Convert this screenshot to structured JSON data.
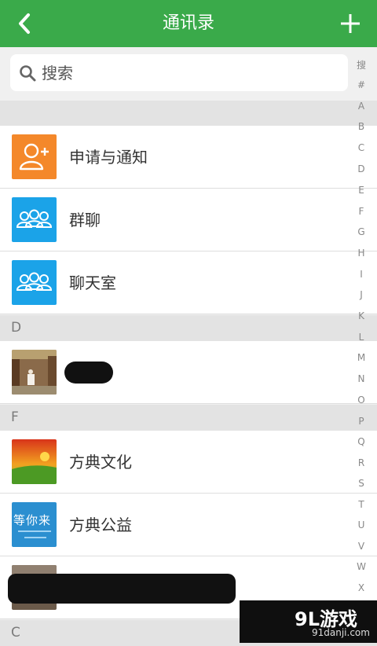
{
  "header": {
    "title": "通讯录",
    "back_icon": "chevron-left-icon",
    "add_icon": "plus-icon",
    "color": "#3aaa4a"
  },
  "search": {
    "placeholder": "搜索",
    "value": ""
  },
  "special_items": [
    {
      "label": "申请与通知",
      "icon": "add-user-icon",
      "color": "#f4882a"
    },
    {
      "label": "群聊",
      "icon": "group-icon",
      "color": "#1ba3e8"
    },
    {
      "label": "聊天室",
      "icon": "group-icon",
      "color": "#1ba3e8"
    }
  ],
  "sections": [
    {
      "letter": "D",
      "contacts": [
        {
          "name": ""
        }
      ]
    },
    {
      "letter": "F",
      "contacts": [
        {
          "name": "方典文化"
        },
        {
          "name": "方典公益"
        },
        {
          "name": ""
        }
      ]
    },
    {
      "letter": "C",
      "contacts": []
    }
  ],
  "thumb_texts": {
    "wait_for_you": "等你来"
  },
  "index_letters": [
    "搜",
    "#",
    "A",
    "B",
    "C",
    "D",
    "E",
    "F",
    "G",
    "H",
    "I",
    "J",
    "K",
    "L",
    "M",
    "N",
    "O",
    "P",
    "Q",
    "R",
    "S",
    "T",
    "U",
    "V",
    "W",
    "X"
  ],
  "watermark": {
    "logo": "9L游戏",
    "url": "91danji.com"
  }
}
